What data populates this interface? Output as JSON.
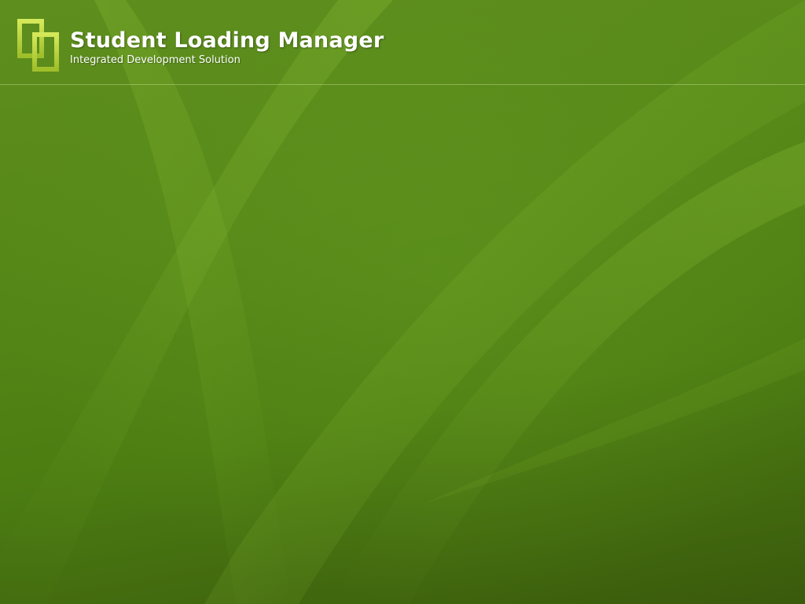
{
  "header": {
    "title": "Student Loading Manager",
    "subtitle": "Integrated Development Solution",
    "logo_icon": "interlocked-squares-logo-icon"
  },
  "colors": {
    "background_top": "#5e8e1e",
    "background_bottom": "#3a5a0c",
    "logo": "#b5d13a",
    "title_text": "#ffffff"
  }
}
